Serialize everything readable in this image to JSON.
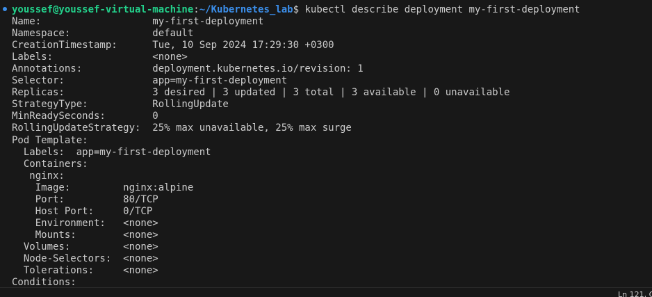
{
  "prompt": {
    "user_host": "youssef@youssef-virtual-machine",
    "separator": ":",
    "path": "~/Kubernetes_lab",
    "symbol": "$",
    "command": " kubectl describe deployment my-first-deployment"
  },
  "output_lines": [
    "Name:                   my-first-deployment",
    "Namespace:              default",
    "CreationTimestamp:      Tue, 10 Sep 2024 17:29:30 +0300",
    "Labels:                 <none>",
    "Annotations:            deployment.kubernetes.io/revision: 1",
    "Selector:               app=my-first-deployment",
    "Replicas:               3 desired | 3 updated | 3 total | 3 available | 0 unavailable",
    "StrategyType:           RollingUpdate",
    "MinReadySeconds:        0",
    "RollingUpdateStrategy:  25% max unavailable, 25% max surge",
    "Pod Template:",
    "  Labels:  app=my-first-deployment",
    "  Containers:",
    "   nginx:",
    "    Image:         nginx:alpine",
    "    Port:          80/TCP",
    "    Host Port:     0/TCP",
    "    Environment:   <none>",
    "    Mounts:        <none>",
    "  Volumes:         <none>",
    "  Node-Selectors:  <none>",
    "  Tolerations:     <none>",
    "Conditions:"
  ],
  "statusbar": {
    "cursor_position": "Ln 121, C"
  }
}
